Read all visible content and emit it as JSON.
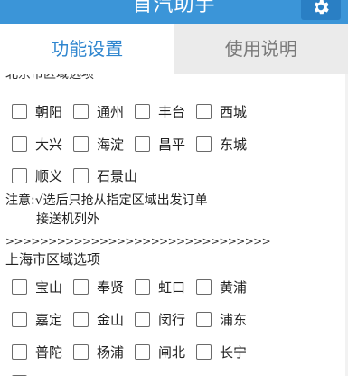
{
  "app": {
    "title": "首汽助手"
  },
  "tabs": [
    {
      "label": "功能设置",
      "active": true
    },
    {
      "label": "使用说明",
      "active": false
    }
  ],
  "beijing": {
    "header": "北京市区域选项",
    "rows": [
      [
        "朝阳",
        "通州",
        "丰台",
        "西城"
      ],
      [
        "大兴",
        "海淀",
        "昌平",
        "东城"
      ],
      [
        "顺义",
        "石景山"
      ]
    ]
  },
  "note": {
    "line1": "注意:√选后只抢从指定区域出发订单",
    "line2": "接送机列外"
  },
  "separator": ">>>>>>>>>>>>>>>>>>>>>>>>>>>>>>>",
  "shanghai": {
    "header": "上海市区域选项",
    "rows": [
      [
        "宝山",
        "奉贤",
        "虹口",
        "黄浦"
      ],
      [
        "嘉定",
        "金山",
        "闵行",
        "浦东"
      ],
      [
        "普陀",
        "杨浦",
        "闸北",
        "长宁"
      ]
    ]
  },
  "colors": {
    "title_bar": "#3b95d8",
    "active_tab_text": "#2f86cf",
    "inactive_tab_bg": "#ebebeb"
  },
  "icons": {
    "settings": "gear-icon"
  }
}
